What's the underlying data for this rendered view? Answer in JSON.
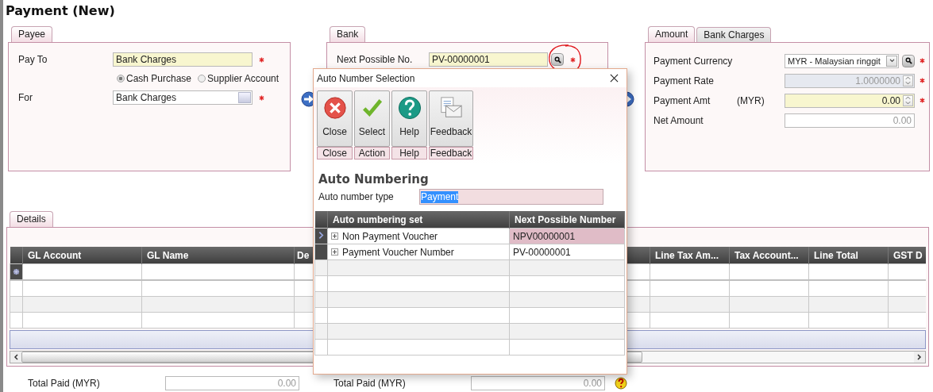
{
  "title": "Payment (New)",
  "payee": {
    "tab": "Payee",
    "pay_to": {
      "label": "Pay To",
      "value": "Bank Charges",
      "highlighted": true,
      "required": true
    },
    "purchase_type": [
      {
        "label": "Cash Purchase",
        "selected": true
      },
      {
        "label": "Supplier Account",
        "selected": false
      }
    ],
    "for": {
      "label": "For",
      "value": "Bank Charges",
      "highlighted": false,
      "required": true
    }
  },
  "bank": {
    "tab": "Bank",
    "next_no": {
      "label": "Next Possible No.",
      "value": "PV-00000001",
      "highlighted": true,
      "required": true
    }
  },
  "amount": {
    "tabs": [
      {
        "label": "Amount",
        "selected": true
      },
      {
        "label": "Bank Charges",
        "selected": false
      }
    ],
    "fields": [
      {
        "kind": "dropdown",
        "label": "Payment Currency",
        "value": "MYR - Malaysian ringgit",
        "disabled": false,
        "highlighted": false,
        "required": true
      },
      {
        "kind": "spinner",
        "label": "Payment Rate",
        "value": "1.0000000",
        "disabled": true,
        "highlighted": false,
        "required": true
      },
      {
        "kind": "spinner",
        "label": "Payment Amt",
        "unit": "(MYR)",
        "value": "0.00",
        "disabled": false,
        "highlighted": true,
        "required": true
      },
      {
        "kind": "text",
        "label": "Net Amount",
        "value": "0.00",
        "disabled": true,
        "highlighted": false,
        "required": false
      }
    ]
  },
  "details": {
    "tab": "Details",
    "columns": [
      "GL Account",
      "GL Name",
      "De",
      "Line Tax Am...",
      "Tax Account...",
      "Line Total",
      "GST D"
    ]
  },
  "totals": [
    {
      "label": "Total Paid (MYR)",
      "value": "0.00"
    },
    {
      "label": "Total Paid (MYR)",
      "value": "0.00"
    }
  ],
  "dialog": {
    "title": "Auto Number Selection",
    "toolbar": [
      {
        "kind": "close",
        "label": "Close",
        "group": "Close"
      },
      {
        "kind": "check",
        "label": "Select",
        "group": "Action"
      },
      {
        "kind": "help",
        "label": "Help",
        "group": "Help"
      },
      {
        "kind": "feedback",
        "label": "Feedback",
        "group": "Feedback"
      }
    ],
    "heading": "Auto Numbering",
    "type_field": {
      "label": "Auto number type",
      "value": "Payment",
      "text_selected": true
    },
    "grid": {
      "columns": [
        "Auto numbering set",
        "Next Possible Number"
      ],
      "rows": [
        {
          "set": "Non Payment Voucher",
          "next": "NPV00000001",
          "selected": true
        },
        {
          "set": "Payment Voucher Number",
          "next": "PV-00000001",
          "selected": false
        }
      ]
    }
  }
}
